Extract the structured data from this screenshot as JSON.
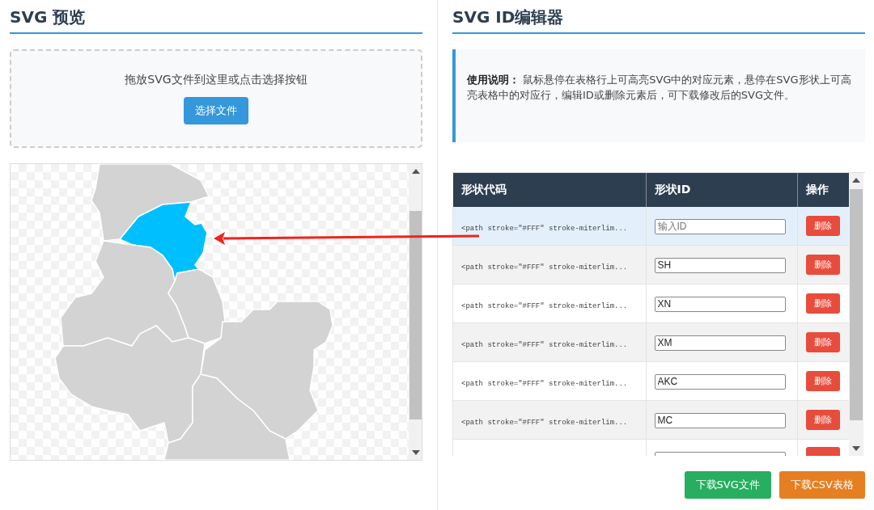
{
  "preview": {
    "title": "SVG 预览",
    "dropzone": {
      "text": "拖放SVG文件到这里或点击选择按钮",
      "button": "选择文件"
    },
    "map": {
      "regions": [
        {
          "highlighted": false
        },
        {
          "highlighted": true
        },
        {
          "highlighted": false
        },
        {
          "highlighted": false
        },
        {
          "highlighted": false
        },
        {
          "highlighted": false
        },
        {
          "highlighted": false
        }
      ]
    }
  },
  "editor": {
    "title": "SVG ID编辑器",
    "instructions": "**使用说明：** 鼠标悬停在表格行上可高亮SVG中的对应元素，悬停在SVG形状上可高亮表格中的对应行，编辑ID或删除元素后，可下载修改后的SVG文件。",
    "table": {
      "columns": [
        "形状代码",
        "形状ID",
        "操作"
      ],
      "rows": [
        {
          "code": "<path stroke=\"#FFF\" stroke-miterlim...",
          "placeholder": "输入ID",
          "action": "删除",
          "hovered": true
        },
        {
          "code": "<path stroke=\"#FFF\" stroke-miterlim...",
          "id": "SH",
          "action": "删除",
          "hovered": false
        },
        {
          "code": "<path stroke=\"#FFF\" stroke-miterlim...",
          "id": "XN",
          "action": "删除",
          "hovered": false
        },
        {
          "code": "<path stroke=\"#FFF\" stroke-miterlim...",
          "id": "XM",
          "action": "删除",
          "hovered": false
        },
        {
          "code": "<path stroke=\"#FFF\" stroke-miterlim...",
          "id": "AKC",
          "action": "删除",
          "hovered": false
        },
        {
          "code": "<path stroke=\"#FFF\" stroke-miterlim...",
          "id": "MC",
          "action": "删除",
          "hovered": false
        },
        {
          "hovered": false
        }
      ]
    },
    "buttons": [
      {
        "label": "下载SVG文件",
        "kind": "svg"
      },
      {
        "label": "下载CSV表格",
        "kind": "csv"
      }
    ]
  }
}
